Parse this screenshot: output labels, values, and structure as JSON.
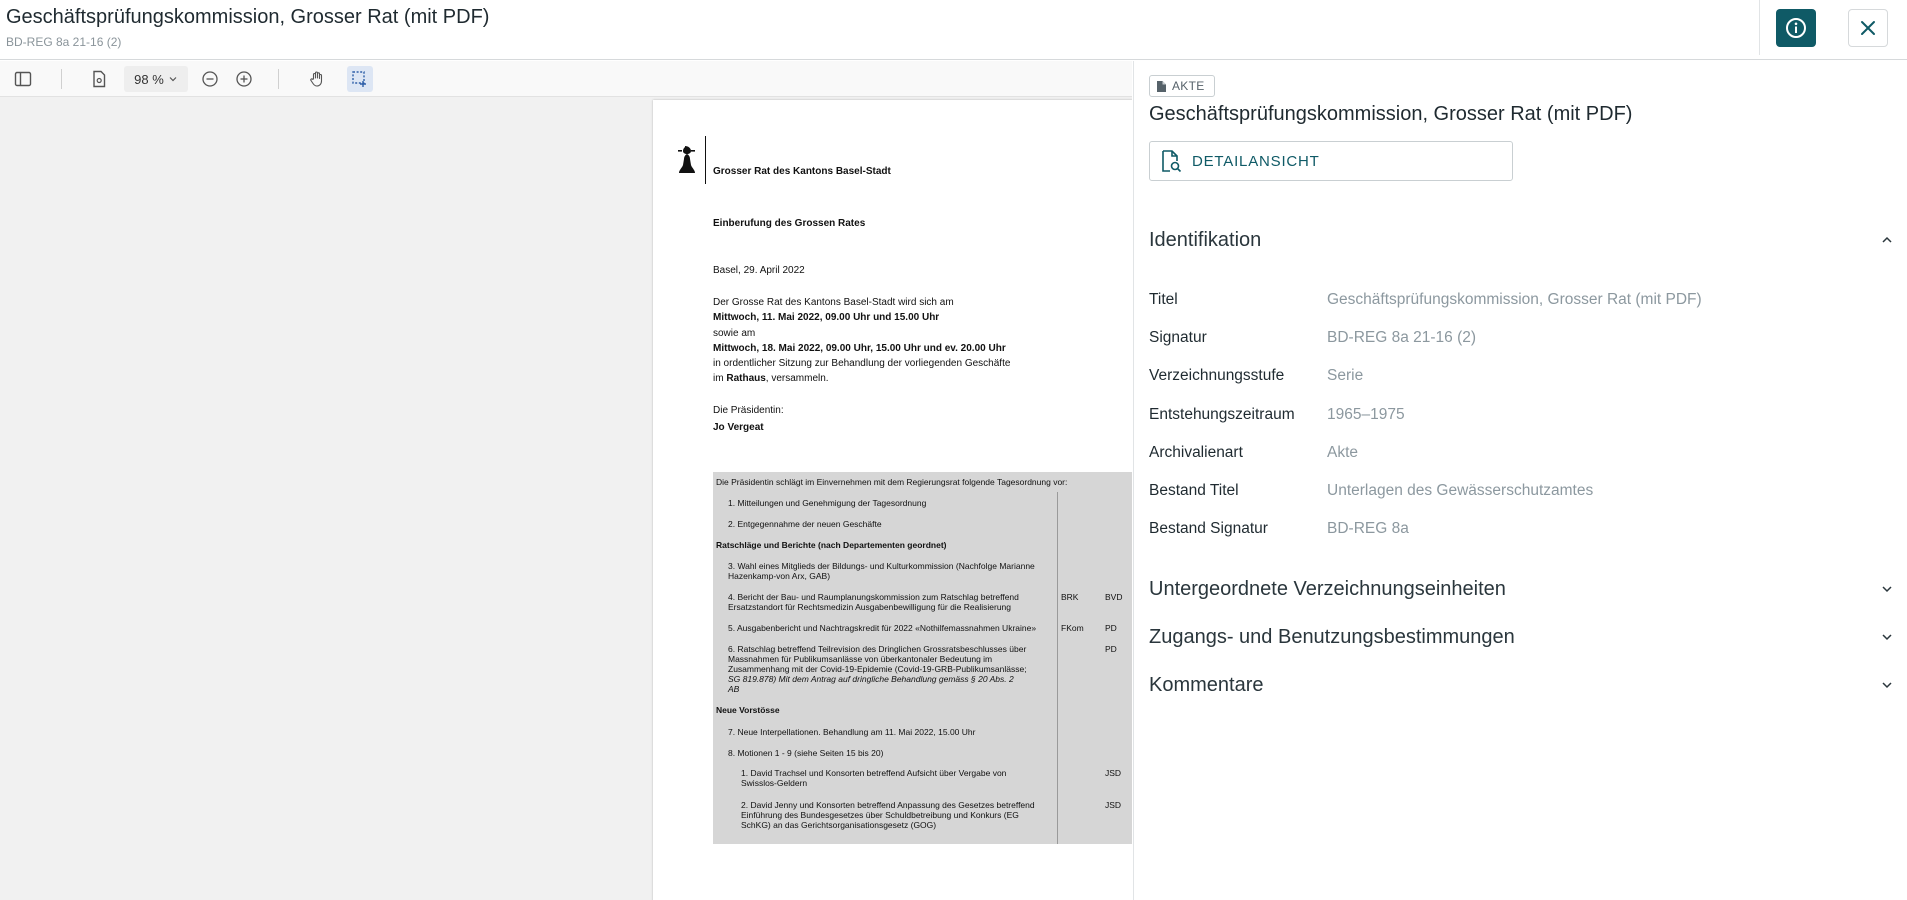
{
  "header": {
    "title": "Geschäftsprüfungskommission, Grosser Rat (mit PDF)",
    "subtitle": "BD-REG 8a 21-16 (2)"
  },
  "toolbar": {
    "zoom": "98 %"
  },
  "pdf": {
    "org": "Grosser Rat des Kantons Basel-Stadt",
    "heading": "Einberufung des Grossen Rates",
    "date": "Basel, 29. April 2022",
    "p1": "Der Grosse Rat des Kantons Basel-Stadt wird sich am",
    "p2": "Mittwoch, 11. Mai 2022, 09.00 Uhr und 15.00 Uhr",
    "p3": "sowie am",
    "p4": "Mittwoch, 18. Mai 2022, 09.00 Uhr, 15.00 Uhr und ev. 20.00 Uhr",
    "p5": "in ordentlicher Sitzung zur Behandlung der vorliegenden Geschäfte",
    "p6a": "im ",
    "p6b": "Rathaus",
    "p6c": ", versammeln.",
    "sig_label": "Die Präsidentin:",
    "sig_name": "Jo Vergeat",
    "table": {
      "intro": "Die Präsidentin schlägt im Einvernehmen mit dem Regierungsrat folgende Tagesordnung vor:",
      "r1": "1.    Mitteilungen und Genehmigung der Tagesordnung",
      "r2": "2.    Entgegennahme der neuen Geschäfte",
      "sec1": "Ratschläge und Berichte (nach Departementen geordnet)",
      "r3a": "3.    Wahl eines Mitglieds der Bildungs- und Kulturkommission (Nachfolge Marianne",
      "r3b": "       Hazenkamp-von Arx, GAB)",
      "r4a": "4.    Bericht der Bau- und Raumplanungskommission zum Ratschlag betreffend",
      "r4b": "       Ersatzstandort für Rechtsmedizin Ausgabenbewilligung für die Realisierung",
      "r4c1": "BRK",
      "r4c2": "BVD",
      "r5": "5.    Ausgabenbericht und Nachtragskredit für 2022 «Nothilfemassnahmen Ukraine»",
      "r5c1": "FKom",
      "r5c2": "PD",
      "r6a": "6.    Ratschlag betreffend Teilrevision des Dringlichen Grossratsbeschlusses über",
      "r6b": "       Massnahmen für Publikumsanlässe von überkantonaler Bedeutung im",
      "r6c": "       Zusammenhang mit der Covid-19-Epidemie (Covid-19-GRB-Publikumsanlässe;",
      "r6d": "       SG 819.878) Mit dem Antrag auf dringliche Behandlung gemäss § 20 Abs. 2",
      "r6e": "       AB",
      "r6c2": "PD",
      "sec2": "Neue Vorstösse",
      "r7": "7.    Neue Interpellationen. Behandlung am 11. Mai 2022, 15.00 Uhr",
      "r8": "8.    Motionen 1 - 9 (siehe Seiten 15 bis 20)",
      "r81a": "1.   David Trachsel und Konsorten betreffend Aufsicht über Vergabe von",
      "r81b": "      Swisslos-Geldern",
      "r81c": "JSD",
      "r82a": "2.   David Jenny und Konsorten betreffend Anpassung des Gesetzes betreffend",
      "r82b": "      Einführung des Bundesgesetzes über Schuldbetreibung und Konkurs (EG",
      "r82c": "      SchKG) an das Gerichtsorganisationsgesetz (GOG)",
      "r82d": "JSD"
    }
  },
  "panel": {
    "badge": "AKTE",
    "title": "Geschäftsprüfungskommission, Grosser Rat (mit PDF)",
    "detail_button": "DETAILANSICHT",
    "sections": {
      "identification": "Identifikation",
      "children": "Untergeordnete Verzeichnungseinheiten",
      "access": "Zugangs- und Benutzungsbestimmungen",
      "comments": "Kommentare"
    },
    "fields": [
      {
        "label": "Titel",
        "value": "Geschäftsprüfungskommission, Grosser Rat (mit PDF)"
      },
      {
        "label": "Signatur",
        "value": "BD-REG 8a 21-16 (2)"
      },
      {
        "label": "Verzeichnungsstufe",
        "value": "Serie"
      },
      {
        "label": "Entstehungszeitraum",
        "value": "1965–1975"
      },
      {
        "label": "Archivalienart",
        "value": "Akte"
      },
      {
        "label": "Bestand Titel",
        "value": "Unterlagen des Gewässerschutzamtes"
      },
      {
        "label": "Bestand Signatur",
        "value": "BD-REG 8a"
      }
    ]
  },
  "colors": {
    "accent": "#0f5a66",
    "muted": "#8c989f"
  }
}
